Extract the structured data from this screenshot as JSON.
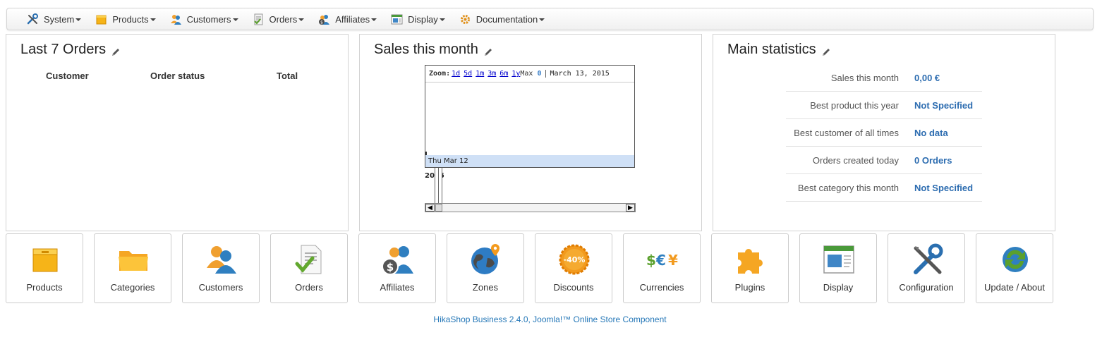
{
  "menu": [
    {
      "label": "System",
      "icon": "tools-icon"
    },
    {
      "label": "Products",
      "icon": "box-icon"
    },
    {
      "label": "Customers",
      "icon": "users-icon"
    },
    {
      "label": "Orders",
      "icon": "order-document-icon"
    },
    {
      "label": "Affiliates",
      "icon": "affiliates-icon"
    },
    {
      "label": "Display",
      "icon": "display-window-icon"
    },
    {
      "label": "Documentation",
      "icon": "documentation-gear-icon"
    }
  ],
  "orders_panel": {
    "title": "Last 7 Orders",
    "columns": [
      "Customer",
      "Order status",
      "Total"
    ]
  },
  "sales_panel": {
    "title": "Sales this month",
    "zoom_label": "Zoom:",
    "zoom_links": [
      "1d",
      "5d",
      "1m",
      "3m",
      "6m",
      "1y"
    ],
    "zoom_max": "Max",
    "value": "0",
    "date": "March 13, 2015",
    "strip_date": "Thu Mar 12",
    "year": "2015"
  },
  "stats_panel": {
    "title": "Main statistics",
    "rows": [
      {
        "label": "Sales this month",
        "value": "0,00 €"
      },
      {
        "label": "Best product this year",
        "value": "Not Specified"
      },
      {
        "label": "Best customer of all times",
        "value": "No data"
      },
      {
        "label": "Orders created today",
        "value": "0 Orders"
      },
      {
        "label": "Best category this month",
        "value": "Not Specified"
      }
    ]
  },
  "tiles": [
    {
      "label": "Products",
      "icon": "box-icon"
    },
    {
      "label": "Categories",
      "icon": "folder-icon"
    },
    {
      "label": "Customers",
      "icon": "customers-icon"
    },
    {
      "label": "Orders",
      "icon": "order-document-icon"
    },
    {
      "label": "Affiliates",
      "icon": "affiliates-icon"
    },
    {
      "label": "Zones",
      "icon": "globe-icon"
    },
    {
      "label": "Discounts",
      "icon": "discount-icon"
    },
    {
      "label": "Currencies",
      "icon": "currencies-icon"
    },
    {
      "label": "Plugins",
      "icon": "puzzle-icon"
    },
    {
      "label": "Display",
      "icon": "display-window-icon"
    },
    {
      "label": "Configuration",
      "icon": "tools-icon"
    },
    {
      "label": "Update / About",
      "icon": "update-icon"
    }
  ],
  "footer": "HikaShop Business 2.4.0, Joomla!™ Online Store Component",
  "colors": {
    "accent": "#2c6cb0",
    "footer": "#2678b8",
    "strip": "#cfe0f6"
  }
}
